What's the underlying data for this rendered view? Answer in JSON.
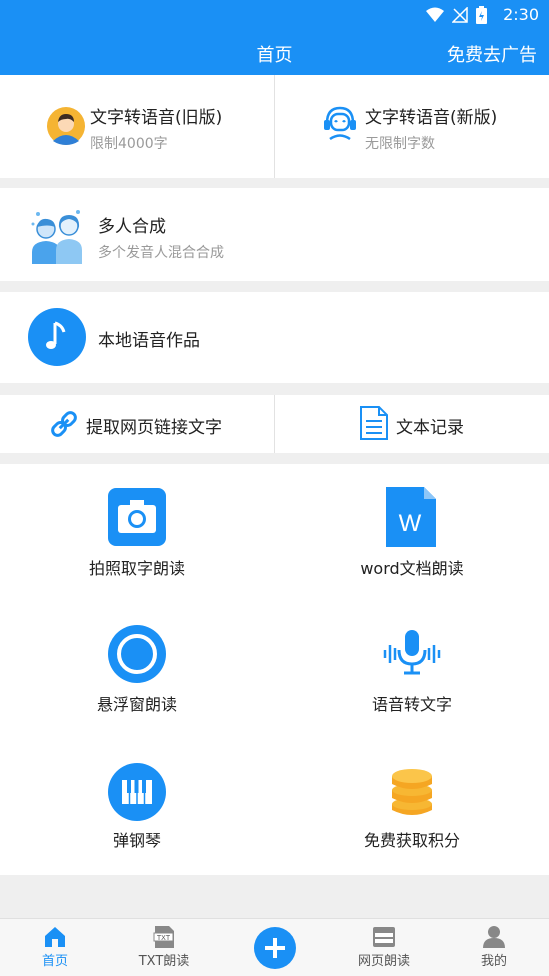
{
  "status_bar": {
    "time": "2:30"
  },
  "header": {
    "title": "首页",
    "ad_label": "免费去广告"
  },
  "tts_old": {
    "title": "文字转语音(旧版)",
    "subtitle": "限制4000字"
  },
  "tts_new": {
    "title": "文字转语音(新版)",
    "subtitle": "无限制字数"
  },
  "multi": {
    "title": "多人合成",
    "subtitle": "多个发音人混合合成"
  },
  "local": {
    "title": "本地语音作品"
  },
  "link": {
    "label": "提取网页链接文字"
  },
  "text_record": {
    "label": "文本记录"
  },
  "grid": {
    "photo": "拍照取字朗读",
    "word": "word文档朗读",
    "float": "悬浮窗朗读",
    "speech": "语音转文字",
    "piano": "弹钢琴",
    "points": "免费获取积分"
  },
  "nav": {
    "home": "首页",
    "txt": "TXT朗读",
    "web": "网页朗读",
    "mine": "我的"
  },
  "colors": {
    "primary": "#1a90f5",
    "accent_orange": "#f5a623"
  }
}
